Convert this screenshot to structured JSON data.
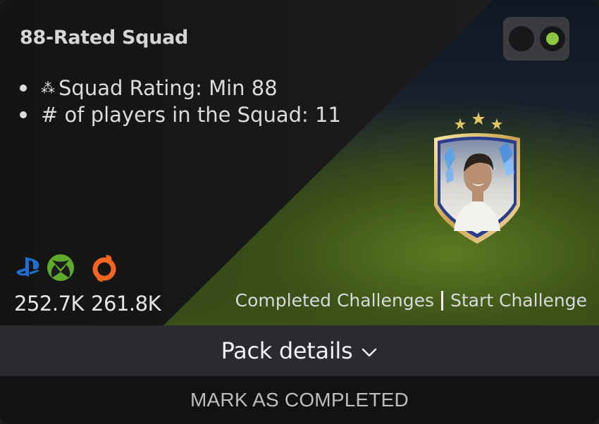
{
  "challenge": {
    "title": "88-Rated Squad",
    "requirements": [
      {
        "icon": "stars-icon",
        "icon_glyph": "⁂",
        "text": "Squad Rating: Min 88"
      },
      {
        "icon": "",
        "icon_glyph": "",
        "text": "# of players in the Squad: 11"
      }
    ],
    "completed_toggle": {
      "state": "on",
      "on_color": "#8dc63f"
    }
  },
  "reward": {
    "icon": "player-card-icon",
    "stars": 3
  },
  "platforms": [
    {
      "name": "playstation-icon",
      "color": "#1f6fd1"
    },
    {
      "name": "xbox-icon",
      "color": "#5faa2a"
    },
    {
      "name": "origin-icon",
      "color": "#f26522"
    }
  ],
  "prices": [
    "252.7K",
    "261.8K"
  ],
  "links": {
    "completed": "Completed Challenges",
    "start": "Start Challenge"
  },
  "pack_details": {
    "label": "Pack details",
    "icon": "chevron-down-icon"
  },
  "mark_completed": {
    "label": "MARK AS COMPLETED"
  }
}
